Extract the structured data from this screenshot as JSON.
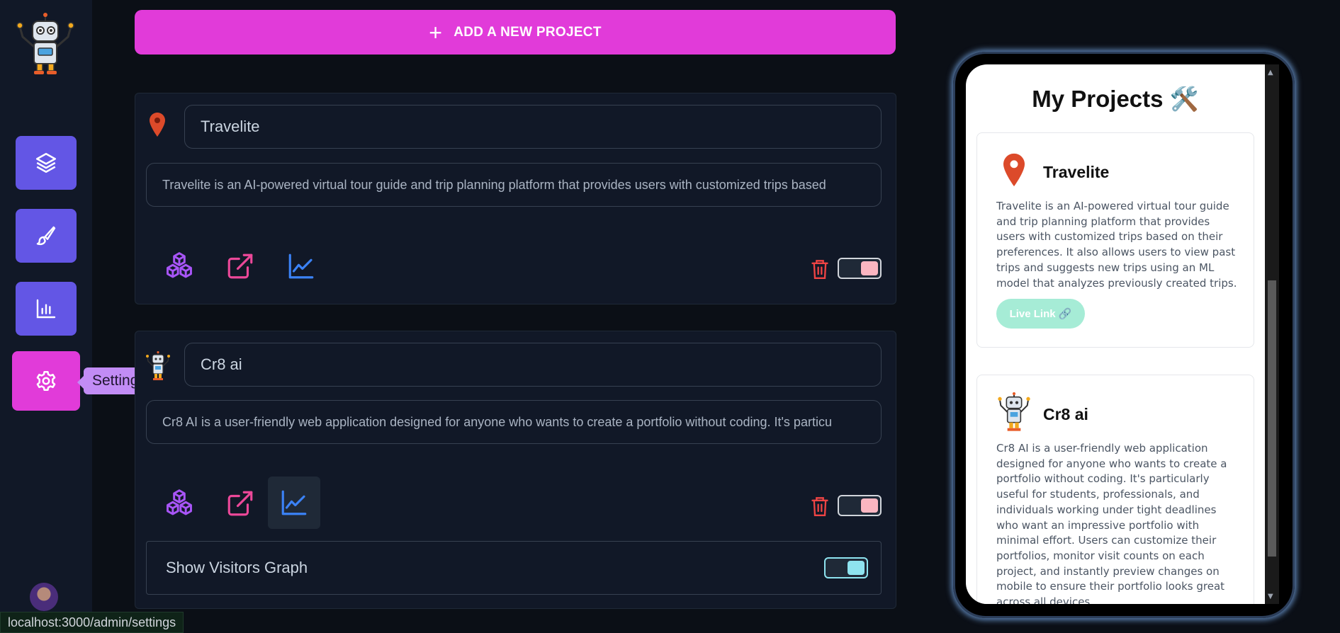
{
  "sidebar": {
    "items": [
      {
        "name": "layers-icon"
      },
      {
        "name": "brush-icon"
      },
      {
        "name": "bar-chart-icon"
      },
      {
        "name": "settings-icon"
      }
    ],
    "tooltip": "Settings"
  },
  "toolbar": {
    "add_label": "ADD A NEW PROJECT"
  },
  "projects": [
    {
      "name": "Travelite",
      "description": "Travelite is an AI-powered virtual tour guide and trip planning platform that provides users with customized trips based",
      "icon": "map-pin-icon",
      "visible_toggle": "on",
      "toggle_color": "#fbb6c1"
    },
    {
      "name": "Cr8 ai",
      "description": "Cr8 AI is a user-friendly web application designed for anyone who wants to create a portfolio without coding. It's particu",
      "icon": "robot-icon",
      "visible_toggle": "on",
      "toggle_color": "#fbb6c1",
      "visitors_graph_label": "Show Visitors Graph",
      "visitors_graph_toggle": "on"
    }
  ],
  "preview": {
    "title": "My Projects 🛠️",
    "cards": [
      {
        "name": "Travelite",
        "description": "Travelite is an AI-powered virtual tour guide and trip planning platform that provides users with customized trips based on their preferences. It also allows users to view past trips and suggests new trips using an ML model that analyzes previously created trips.",
        "link_label": "Live Link 🔗"
      },
      {
        "name": "Cr8 ai",
        "description": "Cr8 AI is a user-friendly web application designed for anyone who wants to create a portfolio without coding. It's particularly useful for students, professionals, and individuals working under tight deadlines who want an impressive portfolio with minimal effort. Users can customize their portfolios, monitor visit counts on each project, and instantly preview changes on mobile to ensure their portfolio looks great across all devices."
      }
    ]
  },
  "status_bar": {
    "url": "localhost:3000/admin/settings"
  },
  "colors": {
    "accent": "#e13bd9",
    "nav": "#6356e5",
    "background": "#0b0f16",
    "card": "#111827"
  }
}
